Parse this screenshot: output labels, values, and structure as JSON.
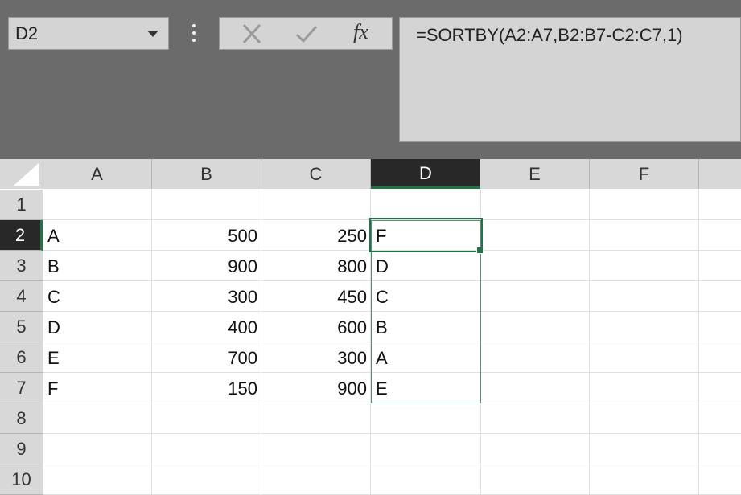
{
  "name_box": {
    "value": "D2",
    "dropdown_icon": "chevron-down-icon"
  },
  "formula_bar": {
    "more_icon": "vertical-ellipsis-icon",
    "cancel_icon": "x-icon",
    "enter_icon": "checkmark-icon",
    "fx_label": "fx",
    "formula": "=SORTBY(A2:A7,B2:B7-C2:C7,1)"
  },
  "grid": {
    "column_headers": [
      "A",
      "B",
      "C",
      "D",
      "E",
      "F"
    ],
    "row_headers": [
      "1",
      "2",
      "3",
      "4",
      "5",
      "6",
      "7",
      "8",
      "9",
      "10"
    ],
    "active_column": "D",
    "active_row": "2",
    "rows": [
      [
        "",
        "",
        "",
        "",
        "",
        ""
      ],
      [
        "A",
        "500",
        "250",
        "F",
        "",
        ""
      ],
      [
        "B",
        "900",
        "800",
        "D",
        "",
        ""
      ],
      [
        "C",
        "300",
        "450",
        "C",
        "",
        ""
      ],
      [
        "D",
        "400",
        "600",
        "B",
        "",
        ""
      ],
      [
        "E",
        "700",
        "300",
        "A",
        "",
        ""
      ],
      [
        "F",
        "150",
        "900",
        "E",
        "",
        ""
      ],
      [
        "",
        "",
        "",
        "",
        "",
        ""
      ],
      [
        "",
        "",
        "",
        "",
        "",
        ""
      ],
      [
        "",
        "",
        "",
        "",
        "",
        ""
      ]
    ]
  },
  "colors": {
    "accent": "#217346",
    "header_bg": "#d8d8d8",
    "active_header_bg": "#282828",
    "toolbar_bg": "#6b6b6b"
  }
}
